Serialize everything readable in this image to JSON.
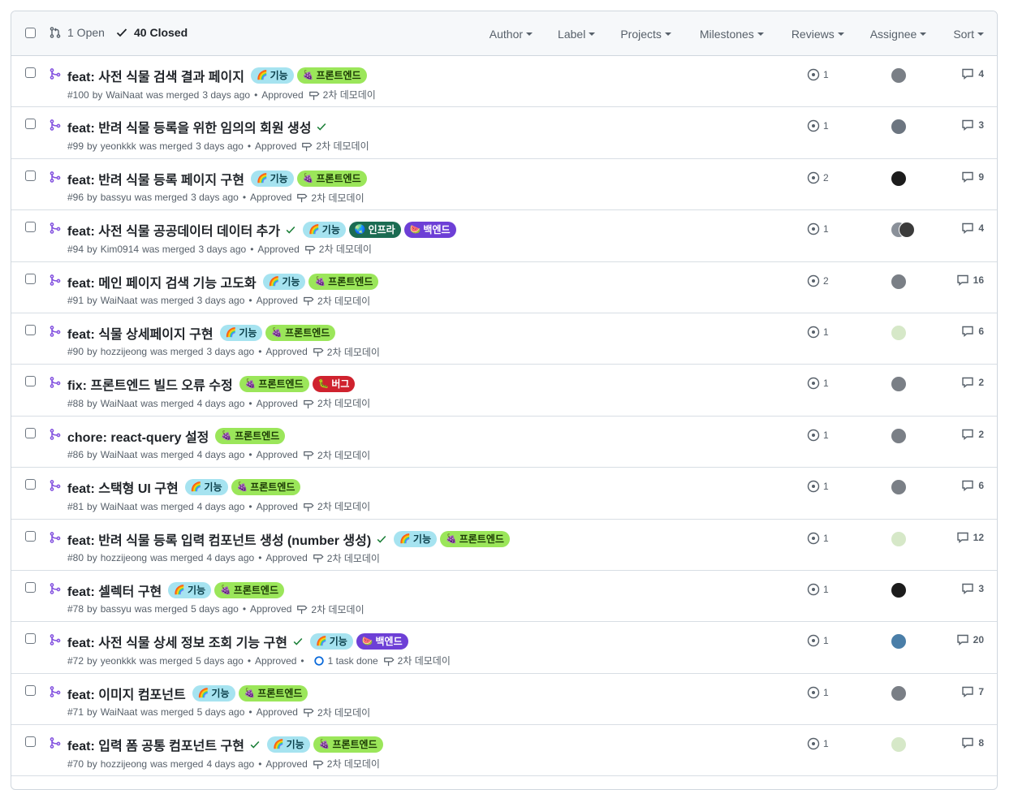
{
  "header": {
    "open_label": "1 Open",
    "closed_label": "40 Closed",
    "filters": [
      "Author",
      "Label",
      "Projects",
      "Milestones",
      "Reviews",
      "Assignee",
      "Sort"
    ]
  },
  "colors": {
    "merged_purple": "#8250df",
    "check_green": "#1a7f37",
    "label_feature_bg": "#a6e3f0",
    "label_frontend_bg": "#9be65a",
    "label_infra_bg": "#1b6b52",
    "label_backend_bg": "#6d3fd6",
    "label_bug_bg": "#cf222e"
  },
  "labels": {
    "feature": {
      "text": "기능",
      "emoji": "🌈"
    },
    "frontend": {
      "text": "프론트엔드",
      "emoji": "🍇"
    },
    "infra": {
      "text": "인프라",
      "emoji": "🌏"
    },
    "backend": {
      "text": "백엔드",
      "emoji": "🍉"
    },
    "bug": {
      "text": "버그",
      "emoji": "🐛"
    }
  },
  "prs": [
    {
      "title": "feat: 사전 식물 검색 결과 페이지",
      "check": false,
      "labels": [
        "feature",
        "frontend"
      ],
      "number": "#100",
      "author": "WaiNaat",
      "merged": "3 days ago",
      "review": "Approved",
      "task": "",
      "milestone": "2차 데모데이",
      "reviews": "1",
      "avatars": [
        "#7a7f86"
      ],
      "comments": "4"
    },
    {
      "title": "feat: 반려 식물 등록을 위한 임의의 회원 생성",
      "check": true,
      "labels": [],
      "number": "#99",
      "author": "yeonkkk",
      "merged": "3 days ago",
      "review": "Approved",
      "task": "",
      "milestone": "2차 데모데이",
      "reviews": "1",
      "avatars": [
        "#6c7580"
      ],
      "comments": "3"
    },
    {
      "title": "feat: 반려 식물 등록 페이지 구현",
      "check": false,
      "labels": [
        "feature",
        "frontend"
      ],
      "number": "#96",
      "author": "bassyu",
      "merged": "3 days ago",
      "review": "Approved",
      "task": "",
      "milestone": "2차 데모데이",
      "reviews": "2",
      "avatars": [
        "#1c1c1c"
      ],
      "comments": "9"
    },
    {
      "title": "feat: 사전 식물 공공데이터 데이터 추가",
      "check": true,
      "labels": [
        "feature",
        "infra",
        "backend"
      ],
      "number": "#94",
      "author": "Kim0914",
      "merged": "3 days ago",
      "review": "Approved",
      "task": "",
      "milestone": "2차 데모데이",
      "reviews": "1",
      "avatars": [
        "#8a9099",
        "#3b3b3b"
      ],
      "comments": "4"
    },
    {
      "title": "feat: 메인 페이지 검색 기능 고도화",
      "check": false,
      "labels": [
        "feature",
        "frontend"
      ],
      "number": "#91",
      "author": "WaiNaat",
      "merged": "3 days ago",
      "review": "Approved",
      "task": "",
      "milestone": "2차 데모데이",
      "reviews": "2",
      "avatars": [
        "#7a7f86"
      ],
      "comments": "16"
    },
    {
      "title": "feat: 식물 상세페이지 구현",
      "check": false,
      "labels": [
        "feature",
        "frontend"
      ],
      "number": "#90",
      "author": "hozzijeong",
      "merged": "3 days ago",
      "review": "Approved",
      "task": "",
      "milestone": "2차 데모데이",
      "reviews": "1",
      "avatars": [
        "#d6e8c8"
      ],
      "comments": "6"
    },
    {
      "title": "fix: 프론트엔드 빌드 오류 수정",
      "check": false,
      "labels": [
        "frontend",
        "bug"
      ],
      "number": "#88",
      "author": "WaiNaat",
      "merged": "4 days ago",
      "review": "Approved",
      "task": "",
      "milestone": "2차 데모데이",
      "reviews": "1",
      "avatars": [
        "#7a7f86"
      ],
      "comments": "2"
    },
    {
      "title": "chore: react-query 설정",
      "check": false,
      "labels": [
        "frontend"
      ],
      "number": "#86",
      "author": "WaiNaat",
      "merged": "4 days ago",
      "review": "Approved",
      "task": "",
      "milestone": "2차 데모데이",
      "reviews": "1",
      "avatars": [
        "#7a7f86"
      ],
      "comments": "2"
    },
    {
      "title": "feat: 스택형 UI 구현",
      "check": false,
      "labels": [
        "feature",
        "frontend"
      ],
      "number": "#81",
      "author": "WaiNaat",
      "merged": "4 days ago",
      "review": "Approved",
      "task": "",
      "milestone": "2차 데모데이",
      "reviews": "1",
      "avatars": [
        "#7a7f86"
      ],
      "comments": "6"
    },
    {
      "title": "feat: 반려 식물 등록 입력 컴포넌트 생성 (number 생성)",
      "check": true,
      "labels": [
        "feature",
        "frontend"
      ],
      "number": "#80",
      "author": "hozzijeong",
      "merged": "4 days ago",
      "review": "Approved",
      "task": "",
      "milestone": "2차 데모데이",
      "reviews": "1",
      "avatars": [
        "#d6e8c8"
      ],
      "comments": "12"
    },
    {
      "title": "feat: 셀렉터 구현",
      "check": false,
      "labels": [
        "feature",
        "frontend"
      ],
      "number": "#78",
      "author": "bassyu",
      "merged": "5 days ago",
      "review": "Approved",
      "task": "",
      "milestone": "2차 데모데이",
      "reviews": "1",
      "avatars": [
        "#1c1c1c"
      ],
      "comments": "3"
    },
    {
      "title": "feat: 사전 식물 상세 정보 조회 기능 구현",
      "check": true,
      "labels": [
        "feature",
        "backend"
      ],
      "number": "#72",
      "author": "yeonkkk",
      "merged": "5 days ago",
      "review": "Approved",
      "task": "1 task done",
      "milestone": "2차 데모데이",
      "reviews": "1",
      "avatars": [
        "#4a7ea8"
      ],
      "comments": "20"
    },
    {
      "title": "feat: 이미지 컴포넌트",
      "check": false,
      "labels": [
        "feature",
        "frontend"
      ],
      "number": "#71",
      "author": "WaiNaat",
      "merged": "5 days ago",
      "review": "Approved",
      "task": "",
      "milestone": "2차 데모데이",
      "reviews": "1",
      "avatars": [
        "#7a7f86"
      ],
      "comments": "7"
    },
    {
      "title": "feat: 입력 폼 공통 컴포넌트 구현",
      "check": true,
      "labels": [
        "feature",
        "frontend"
      ],
      "number": "#70",
      "author": "hozzijeong",
      "merged": "4 days ago",
      "review": "Approved",
      "task": "",
      "milestone": "2차 데모데이",
      "reviews": "1",
      "avatars": [
        "#d6e8c8"
      ],
      "comments": "8"
    }
  ]
}
